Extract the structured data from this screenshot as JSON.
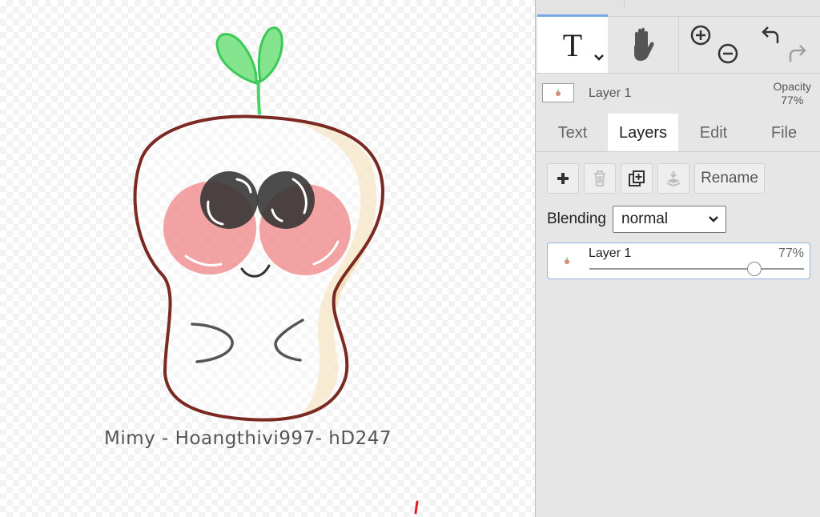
{
  "canvas": {
    "artwork_caption": "Mimy - Hoangthivi997- hD247"
  },
  "toolbar": {
    "text_tool_glyph": "T",
    "hand_tool_icon": "hand-icon",
    "zoom_in_icon": "zoom-in-icon",
    "zoom_out_icon": "zoom-out-icon",
    "undo_icon": "undo-icon",
    "redo_icon": "redo-icon"
  },
  "layer_info": {
    "name": "Layer 1",
    "opacity_label": "Opacity",
    "opacity_value": "77%"
  },
  "tabs": [
    {
      "label": "Text",
      "active": false
    },
    {
      "label": "Layers",
      "active": true
    },
    {
      "label": "Edit",
      "active": false
    },
    {
      "label": "File",
      "active": false
    }
  ],
  "layer_actions": {
    "add_icon": "plus-icon",
    "delete_icon": "trash-icon",
    "duplicate_icon": "duplicate-icon",
    "merge_down_icon": "merge-down-icon",
    "rename_label": "Rename"
  },
  "blending": {
    "label": "Blending",
    "selected": "normal"
  },
  "layers": [
    {
      "name": "Layer 1",
      "opacity_text": "77%",
      "opacity": 0.77
    }
  ],
  "colors": {
    "panel_bg": "#e6e6e6",
    "active_tab_bg": "#ffffff",
    "selection_border": "#8fb2e8",
    "accent_line": "#7aa7e8"
  }
}
